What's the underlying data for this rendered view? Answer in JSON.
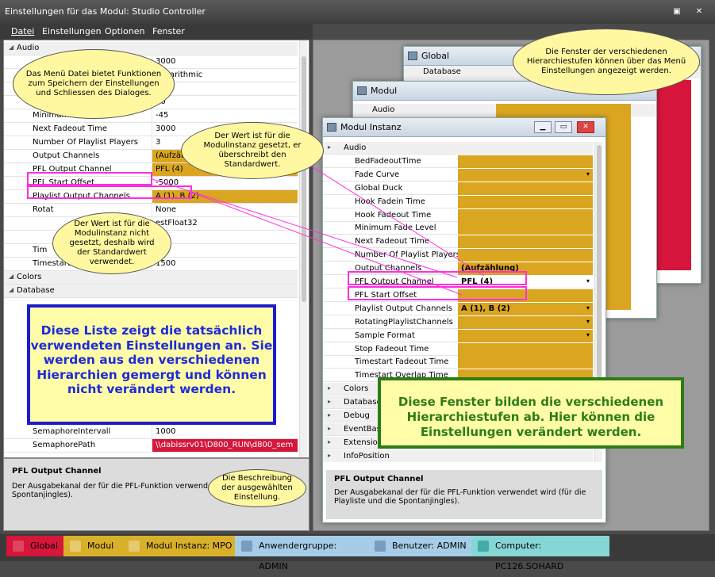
{
  "window": {
    "title": "Einstellungen für das Modul: Studio Controller"
  },
  "menu": [
    "Datei",
    "Einstellungen",
    "Optionen",
    "Fenster"
  ],
  "left": {
    "rows": [
      {
        "name": "Audio",
        "value": "",
        "type": "cat"
      },
      {
        "name": "",
        "value": "3000",
        "type": "plain"
      },
      {
        "name": "",
        "value": "Logarithmic",
        "type": "plain"
      },
      {
        "name": "",
        "value": "",
        "type": "plain"
      },
      {
        "name": "Hook",
        "value": "10",
        "type": "plain"
      },
      {
        "name": "Minimum Fade Level",
        "value": "-45",
        "type": "plain"
      },
      {
        "name": "Next Fadeout Time",
        "value": "3000",
        "type": "plain"
      },
      {
        "name": "Number Of Playlist Players",
        "value": "3",
        "type": "plain"
      },
      {
        "name": "Output Channels",
        "value": "(Aufzählung)",
        "type": "gold"
      },
      {
        "name": "PFL Output Channel",
        "value": "PFL (4)",
        "type": "gold"
      },
      {
        "name": "PFL Start Offset",
        "value": "-5000",
        "type": "plain"
      },
      {
        "name": "Playlist Output Channels",
        "value": "A (1), B (2)",
        "type": "gold"
      },
      {
        "name": "Rotat",
        "value": "None",
        "type": "plain"
      },
      {
        "name": "",
        "value": "estFloat32",
        "type": "plain"
      },
      {
        "name": "",
        "value": "",
        "type": "plain"
      },
      {
        "name": "Tim",
        "value": "",
        "type": "plain"
      },
      {
        "name": "Timestart O",
        "value": "1500",
        "type": "plain"
      },
      {
        "name": "Colors",
        "value": "",
        "type": "cat"
      },
      {
        "name": "Database",
        "value": "",
        "type": "cat"
      }
    ],
    "lower_rows": [
      {
        "name": "SemaphoreIntervall",
        "value": "1000",
        "type": "plain"
      },
      {
        "name": "SemaphorePath",
        "value": "\\\\dabissrv01\\D800_RUN\\d800_sem",
        "type": "red"
      }
    ],
    "desc_title": "PFL Output Channel",
    "desc_text": "Der Ausgabekanal der für die PFL-Funktion verwendet wird (für die Spontanjingles)."
  },
  "win_global": {
    "title": "Global",
    "row": "Database"
  },
  "win_modul": {
    "title": "Modul",
    "row": "Audio"
  },
  "win_instanz": {
    "title": "Modul Instanz",
    "rows": [
      {
        "name": "Audio",
        "value": "",
        "type": "cat"
      },
      {
        "name": "BedFadeoutTime",
        "value": "",
        "type": "gold"
      },
      {
        "name": "Fade Curve",
        "value": "",
        "type": "gold",
        "dd": true
      },
      {
        "name": "Global Duck",
        "value": "",
        "type": "gold"
      },
      {
        "name": "Hook Fadein Time",
        "value": "",
        "type": "gold"
      },
      {
        "name": "Hook Fadeout Time",
        "value": "",
        "type": "gold"
      },
      {
        "name": "Minimum Fade Level",
        "value": "",
        "type": "gold"
      },
      {
        "name": "Next Fadeout Time",
        "value": "",
        "type": "gold"
      },
      {
        "name": "Number Of Playlist Players",
        "value": "",
        "type": "gold"
      },
      {
        "name": "Output Channels",
        "value": "(Aufzählung)",
        "type": "gold"
      },
      {
        "name": "PFL Output Channel",
        "value": "PFL (4)",
        "type": "plain",
        "dd": true
      },
      {
        "name": "PFL Start Offset",
        "value": "",
        "type": "gold"
      },
      {
        "name": "Playlist Output Channels",
        "value": "A (1), B (2)",
        "type": "gold",
        "dd": true
      },
      {
        "name": "RotatingPlaylistChannels",
        "value": "",
        "type": "gold",
        "dd": true
      },
      {
        "name": "Sample Format",
        "value": "",
        "type": "gold",
        "dd": true
      },
      {
        "name": "Stop Fadeout Time",
        "value": "",
        "type": "gold"
      },
      {
        "name": "Timestart Fadeout Time",
        "value": "",
        "type": "gold"
      },
      {
        "name": "Timestart Overlap Time",
        "value": "",
        "type": "gold"
      },
      {
        "name": "Colors",
        "value": "",
        "type": "cat"
      },
      {
        "name": "Database",
        "value": "",
        "type": "cat"
      },
      {
        "name": "Debug",
        "value": "",
        "type": "cat"
      },
      {
        "name": "EventBas",
        "value": "",
        "type": "cat"
      },
      {
        "name": "Extension",
        "value": "",
        "type": "cat"
      },
      {
        "name": "InfoPosition",
        "value": "",
        "type": "cat"
      }
    ],
    "desc_title": "PFL Output Channel",
    "desc_text": "Der Ausgabekanal der für die PFL-Funktion verwendet wird (für die Playliste und die Spontanjingles)."
  },
  "bubbles": {
    "menu": "Das Menü Datei bietet Funktionen zum Speichern der Einstellungen und Schliessen des Dialoges.",
    "set": "Der Wert ist für die Modulinstanz gesetzt, er überschreibt den Standardwert.",
    "notset": "Der Wert ist für die Modulinstanz nicht gesetzt, deshalb wird der Standardwert verwendet.",
    "windows": "Die Fenster der verschiedenen Hierarchiestufen können über das Menü Einstellungen angezeigt werden.",
    "desc": "Die Beschreibung der ausgewählten Einstellung."
  },
  "bluebox": "Diese Liste zeigt die tatsächlich verwendeten Einstellungen an. Sie werden aus den verschiedenen Hierarchien gemergt und können nicht verändert werden.",
  "greenbox": "Diese Fenster bilden die verschiedenen Hierarchiestufen ab. Hier können die Einstellungen verändert werden.",
  "taskbar": [
    {
      "label": "Global",
      "color": "#d6163a"
    },
    {
      "label": "Modul",
      "color": "#d9b02a"
    },
    {
      "label": "Modul Instanz: MPO",
      "color": "#d9b02a"
    },
    {
      "label": "Anwendergruppe: ADMIN",
      "color": "#a5cde8"
    },
    {
      "label": "Benutzer: ADMIN",
      "color": "#a5cde8"
    },
    {
      "label": "Computer: PC126.SOHARD",
      "color": "#86d6d6"
    }
  ]
}
